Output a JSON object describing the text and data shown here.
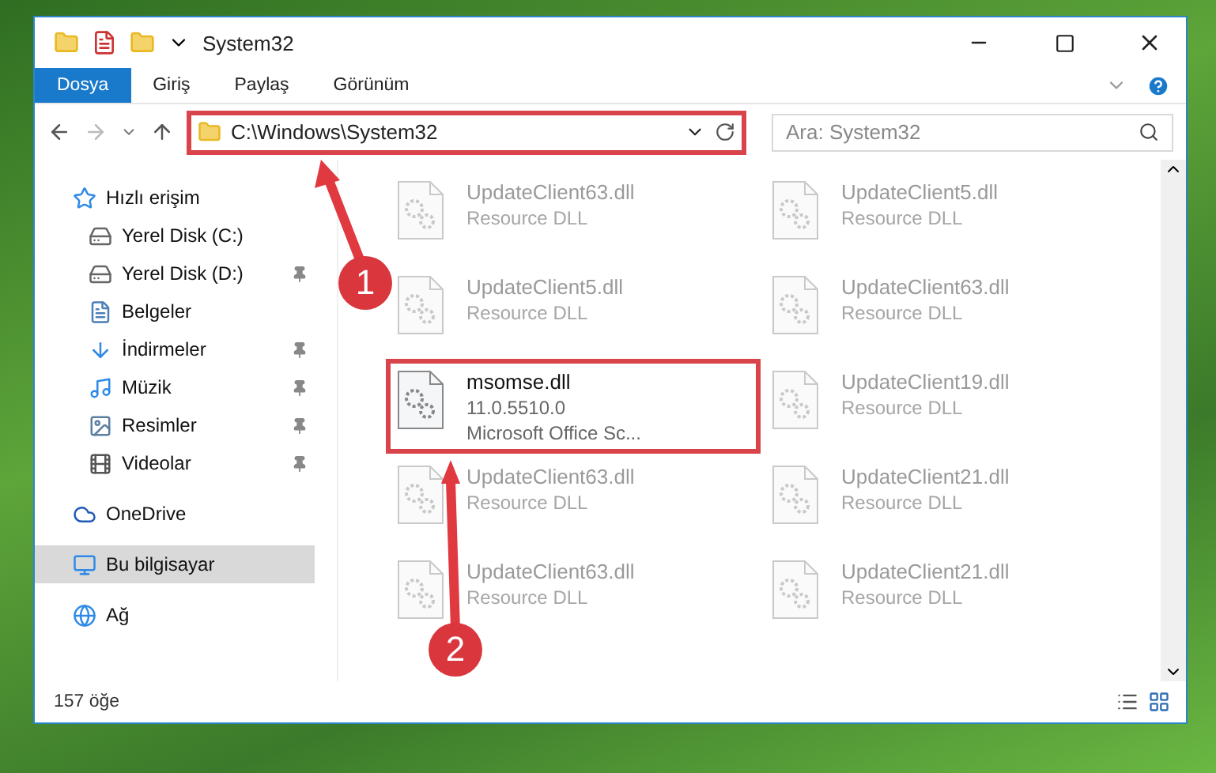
{
  "window": {
    "title": "System32"
  },
  "ribbon_tabs": [
    {
      "label": "Dosya",
      "selected": true
    },
    {
      "label": "Giriş",
      "selected": false
    },
    {
      "label": "Paylaş",
      "selected": false
    },
    {
      "label": "Görünüm",
      "selected": false
    }
  ],
  "address": {
    "path": "C:\\Windows\\System32",
    "highlighted": true
  },
  "search": {
    "placeholder": "Ara: System32"
  },
  "sidebar": {
    "items": [
      {
        "label": "Hızlı erişim",
        "kind": "star",
        "selected": false,
        "children": [
          {
            "label": "Yerel Disk (C:)",
            "kind": "drive",
            "selected": false,
            "pinned": false
          },
          {
            "label": "Yerel Disk (D:)",
            "kind": "drive",
            "selected": false,
            "pinned": true
          },
          {
            "label": "Belgeler",
            "kind": "doc",
            "selected": false,
            "pinned": false
          },
          {
            "label": "İndirmeler",
            "kind": "download",
            "selected": false,
            "pinned": true
          },
          {
            "label": "Müzik",
            "kind": "music",
            "selected": false,
            "pinned": true
          },
          {
            "label": "Resimler",
            "kind": "pictures",
            "selected": false,
            "pinned": true
          },
          {
            "label": "Videolar",
            "kind": "video",
            "selected": false,
            "pinned": true
          }
        ]
      },
      {
        "label": "OneDrive",
        "kind": "cloud",
        "selected": false
      },
      {
        "label": "Bu bilgisayar",
        "kind": "pc",
        "selected": true
      },
      {
        "label": "Ağ",
        "kind": "network",
        "selected": false
      }
    ]
  },
  "files": [
    {
      "name": "UpdateClient63.dll",
      "lines": [
        "Resource DLL"
      ],
      "faded": true,
      "highlighted": false
    },
    {
      "name": "UpdateClient5.dll",
      "lines": [
        "Resource DLL"
      ],
      "faded": true,
      "highlighted": false
    },
    {
      "name": "UpdateClient5.dll",
      "lines": [
        "Resource DLL"
      ],
      "faded": true,
      "highlighted": false
    },
    {
      "name": "UpdateClient63.dll",
      "lines": [
        "Resource DLL"
      ],
      "faded": true,
      "highlighted": false
    },
    {
      "name": "msomse.dll",
      "lines": [
        "11.0.5510.0",
        "Microsoft Office Sc..."
      ],
      "faded": false,
      "highlighted": true
    },
    {
      "name": "UpdateClient19.dll",
      "lines": [
        "Resource DLL"
      ],
      "faded": true,
      "highlighted": false
    },
    {
      "name": "UpdateClient63.dll",
      "lines": [
        "Resource DLL"
      ],
      "faded": true,
      "highlighted": false
    },
    {
      "name": "UpdateClient21.dll",
      "lines": [
        "Resource DLL"
      ],
      "faded": true,
      "highlighted": false
    },
    {
      "name": "UpdateClient63.dll",
      "lines": [
        "Resource DLL"
      ],
      "faded": true,
      "highlighted": false
    },
    {
      "name": "UpdateClient21.dll",
      "lines": [
        "Resource DLL"
      ],
      "faded": true,
      "highlighted": false
    }
  ],
  "status_bar": {
    "count": "157 öğe"
  },
  "annotations": [
    {
      "number": "1"
    },
    {
      "number": "2"
    }
  ]
}
